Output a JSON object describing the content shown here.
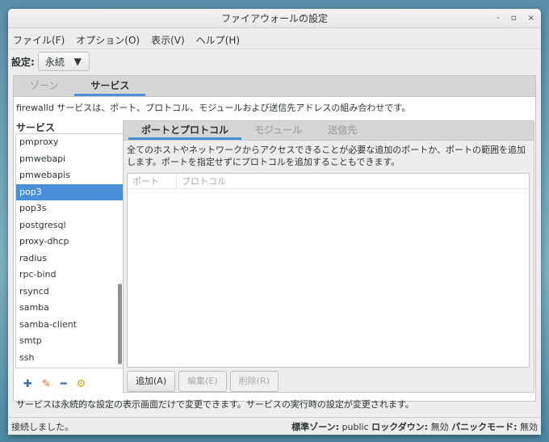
{
  "window": {
    "title": "ファイアウォールの設定",
    "minimize": "‐",
    "maximize": "▫",
    "close": "×"
  },
  "menu": [
    "ファイル(F)",
    "オプション(O)",
    "表示(V)",
    "ヘルプ(H)"
  ],
  "settings": {
    "label": "設定:",
    "value": "永続"
  },
  "tabs": [
    "ゾーン",
    "サービス"
  ],
  "description": "firewalld サービスは、ポート、プロトコル、モジュールおよび送信先アドレスの組み合わせです。",
  "services": {
    "label": "サービス",
    "items": [
      "pmproxy",
      "pmwebapi",
      "pmwebapis",
      "pop3",
      "pop3s",
      "postgresql",
      "proxy-dhcp",
      "radius",
      "rpc-bind",
      "rsyncd",
      "samba",
      "samba-client",
      "smtp",
      "ssh"
    ],
    "selected": "pop3"
  },
  "subtabs": [
    "ポートとプロトコル",
    "モジュール",
    "送信先"
  ],
  "ports": {
    "description": "全てのホストやネットワークからアクセスできることが必要な追加のポートか、ポートの範囲を追加します。ポートを指定せずにプロトコルを追加することもできます。",
    "columns": [
      "ポート",
      "プロトコル"
    ],
    "buttons": {
      "add": "追加(A)",
      "edit": "編集(E)",
      "remove": "削除(R)"
    }
  },
  "footer": "サービスは永続的な設定の表示画面だけで変更できます。サービスの実行時の設定が変更されます。",
  "status": {
    "message": "接続しました。",
    "zone_label": "標準ゾーン:",
    "zone": "public",
    "lockdown_label": "ロックダウン:",
    "lockdown": "無効",
    "panic_label": "パニックモード:",
    "panic": "無効"
  }
}
